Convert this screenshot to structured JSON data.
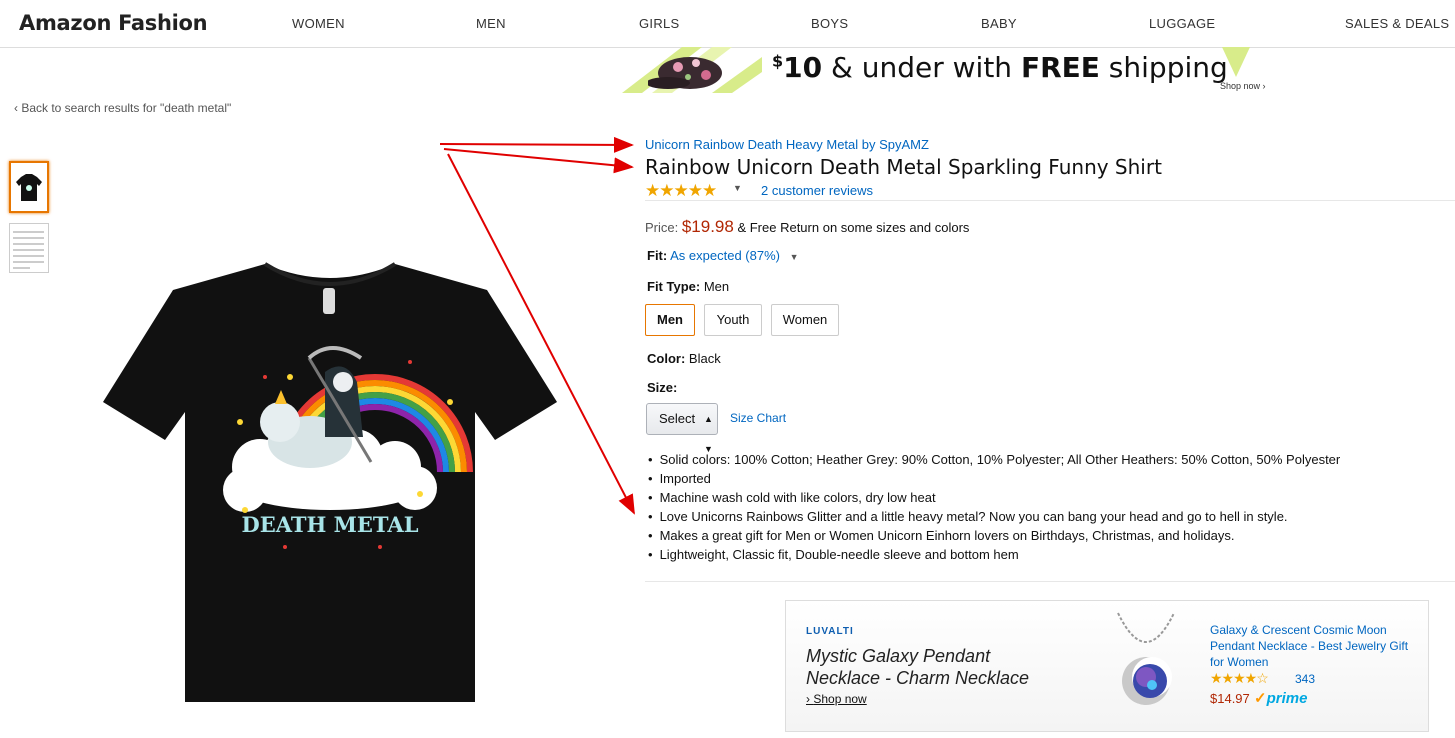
{
  "header": {
    "brand": "Amazon Fashion",
    "nav": [
      "WOMEN",
      "MEN",
      "GIRLS",
      "BOYS",
      "BABY",
      "LUGGAGE",
      "SALES & DEALS"
    ]
  },
  "banner": {
    "dollar": "$",
    "amount": "10",
    "text_mid": " & under with ",
    "text_bold": "FREE",
    "text_end": " shipping",
    "shop_now": "Shop now ›"
  },
  "back_link": "‹ Back to search results for \"death metal\"",
  "product": {
    "byline": "Unicorn Rainbow Death Heavy Metal by SpyAMZ",
    "title": "Rainbow Unicorn Death Metal Sparkling Funny Shirt",
    "stars": "★★★★★",
    "rating": 5,
    "reviews": "2 customer reviews",
    "price_label": "Price: ",
    "price": "$19.98",
    "price_note": " & Free Return on some sizes and colors",
    "fit_label": "Fit:",
    "fit_value": "As expected (87%)",
    "fit_type_label": "Fit Type:",
    "fit_type_value": "Men",
    "fit_options": [
      "Men",
      "Youth",
      "Women"
    ],
    "color_label": "Color:",
    "color_value": "Black",
    "size_label": "Size:",
    "size_select": "Select",
    "size_chart": "Size Chart",
    "shirt_text": "DEATH METAL",
    "bullets": [
      "Solid colors: 100% Cotton; Heather Grey: 90% Cotton, 10% Polyester; All Other Heathers: 50% Cotton, 50% Polyester",
      "Imported",
      "Machine wash cold with like colors, dry low heat",
      "Love Unicorns Rainbows Glitter and a little heavy metal? Now you can bang your head and go to hell in style.",
      "Makes a great gift for Men or Women Unicorn Einhorn lovers on Birthdays, Christmas, and holidays.",
      "Lightweight, Classic fit, Double-needle sleeve and bottom hem"
    ]
  },
  "ad": {
    "brand": "LUVALTI",
    "headline": "Mystic Galaxy Pendant Necklace - Charm Necklace",
    "shop_now": "Shop now",
    "product_title": "Galaxy & Crescent Cosmic Moon Pendant Necklace - Best Jewelry Gift for Women",
    "stars": "★★★★☆",
    "rating": 4,
    "review_count": "343",
    "price": "$14.97",
    "prime": "prime"
  },
  "colors": {
    "link": "#0066c0",
    "price": "#b12704",
    "selected_border": "#e77600",
    "star": "#f0a500",
    "annotation_arrow": "#e00000"
  }
}
